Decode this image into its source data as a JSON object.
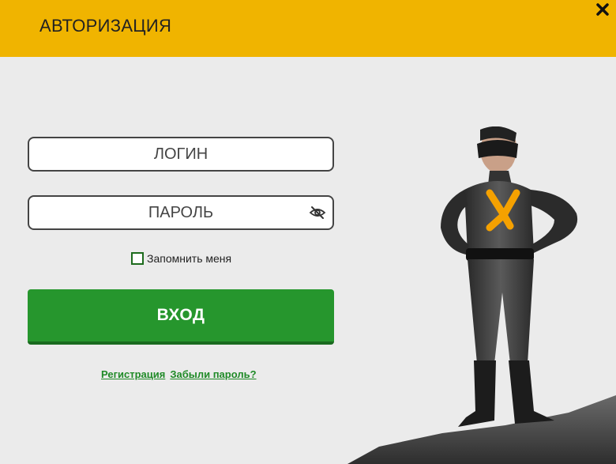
{
  "header": {
    "title": "АВТОРИЗАЦИЯ"
  },
  "form": {
    "login_placeholder": "ЛОГИН",
    "password_placeholder": "ПАРОЛЬ",
    "remember_label": "Запомнить меня",
    "remember_checked": false,
    "submit_label": "ВХОД"
  },
  "links": {
    "register": "Регистрация",
    "forgot": "Забыли пароль?"
  },
  "icons": {
    "close": "close-icon",
    "password_toggle": "eye-off-icon",
    "mascot": "superhero-illustration"
  },
  "colors": {
    "header_bg": "#f0b400",
    "page_bg": "#ebebeb",
    "button_bg": "#26962d",
    "link": "#1f8a27",
    "accent_logo": "#f5a100"
  }
}
